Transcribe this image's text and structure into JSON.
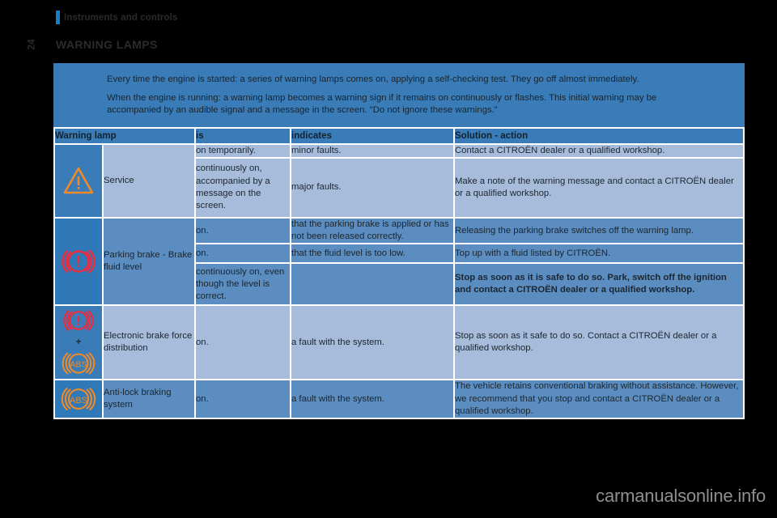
{
  "header": {
    "running_title": "Instruments and controls",
    "page_number": "24",
    "section_title": "WARNING LAMPS"
  },
  "intro": {
    "paragraphs": [
      "Every time the engine is started: a series of warning lamps comes on, applying a self-checking test. They go off almost immediately.",
      "When the engine is running: a warning lamp becomes a warning sign if it remains on continuously or flashes. This initial warning may be accompanied by an audible signal and a message in the screen. \"Do not ignore these warnings.\""
    ]
  },
  "table": {
    "columns": {
      "lamp": "Warning lamp",
      "is": "is",
      "indicates": "indicates",
      "solution": "Solution - action"
    },
    "rows": [
      {
        "icon": "warning-triangle-icon",
        "name": "Service",
        "entries": [
          {
            "is": "on temporarily.",
            "indicates": "minor faults.",
            "solution": "Contact a CITROËN dealer or a qualified workshop.",
            "bold": false
          },
          {
            "is": "continuously on, accompanied by a message on the screen.",
            "indicates": "major faults.",
            "solution": "Make a note of the warning message and contact a CITROËN dealer or a qualified workshop.",
            "bold": false
          }
        ]
      },
      {
        "icon": "brake-warning-icon",
        "name": "Parking brake - Brake fluid level",
        "entries": [
          {
            "is": "on.",
            "indicates": "that the parking brake is applied or has not been released correctly.",
            "solution": "Releasing the parking brake switches off the warning lamp.",
            "bold": false
          },
          {
            "is": "on.",
            "indicates": "that the fluid level is too low.",
            "solution": "Top up with a fluid listed by CITROËN.",
            "bold": false
          },
          {
            "is": "continuously on, even though the level is correct.",
            "indicates": "",
            "solution": "Stop as soon as it is safe to do so. Park, switch off the ignition and contact a CITROËN dealer or a qualified workshop.",
            "bold": true
          }
        ]
      },
      {
        "icon": "brake-plus-abs-icon",
        "icon_plus": "+",
        "name": "Electronic brake force distribution",
        "entries": [
          {
            "is": "on.",
            "indicates": "a fault with the system.",
            "solution": "Stop as soon as it safe to do so. Contact a CITROËN dealer or a qualified workshop.",
            "bold": false
          }
        ]
      },
      {
        "icon": "abs-icon",
        "name": "Anti-lock braking system",
        "entries": [
          {
            "is": "on.",
            "indicates": "a fault with the system.",
            "solution": "The vehicle retains conventional braking without assistance. However, we recommend that you stop and contact a CITROËN dealer or a qualified workshop.",
            "bold": false
          }
        ]
      }
    ]
  },
  "footer": {
    "watermark": "carmanualsonline.info"
  },
  "colors": {
    "accent_blue": "#1580c8",
    "panel_blue": "#3a7cb8",
    "row_light": "#a7bcdb",
    "row_dark": "#5b8dc0",
    "warning_orange": "#f08a28",
    "warning_red": "#ee2b3c",
    "page_background": "#000000"
  }
}
